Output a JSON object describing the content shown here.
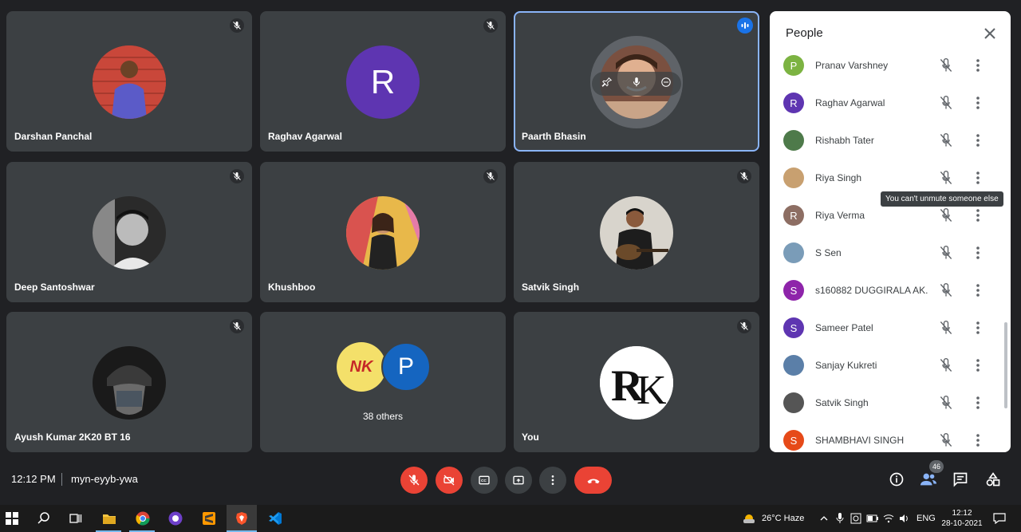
{
  "tiles": [
    {
      "name": "Darshan Panchal"
    },
    {
      "name": "Raghav Agarwal",
      "letter": "R"
    },
    {
      "name": "Paarth Bhasin"
    },
    {
      "name": "Deep Santoshwar"
    },
    {
      "name": "Khushboo"
    },
    {
      "name": "Satvik Singh"
    },
    {
      "name": "Ayush Kumar 2K20 BT 16"
    },
    {
      "name": "38 others",
      "letter": "P",
      "letter2": "NK"
    },
    {
      "name": "You"
    }
  ],
  "people_panel": {
    "title": "People",
    "tooltip": "You can't unmute someone else",
    "people": [
      {
        "name": "Pranav Varshney",
        "letter": "P",
        "color": "#7cb342"
      },
      {
        "name": "Raghav Agarwal",
        "letter": "R",
        "color": "#5e35b1"
      },
      {
        "name": "Rishabh Tater",
        "letter": "",
        "color": "#4e7a4a"
      },
      {
        "name": "Riya Singh",
        "letter": "",
        "color": "#c8a070"
      },
      {
        "name": "Riya Verma",
        "letter": "R",
        "color": "#8d6e63"
      },
      {
        "name": "S Sen",
        "letter": "",
        "color": "#7a9cb8"
      },
      {
        "name": "s160882 DUGGIRALA AK...",
        "letter": "S",
        "color": "#8e24aa"
      },
      {
        "name": "Sameer Patel",
        "letter": "S",
        "color": "#5e35b1"
      },
      {
        "name": "Sanjay Kukreti",
        "letter": "",
        "color": "#5b7fa8"
      },
      {
        "name": "Satvik Singh",
        "letter": "",
        "color": "#555555"
      },
      {
        "name": "SHAMBHAVI SINGH",
        "letter": "S",
        "color": "#e64a19"
      }
    ]
  },
  "bottom_bar": {
    "time": "12:12 PM",
    "meeting_code": "myn-eyyb-ywa",
    "participants_count": "46"
  },
  "taskbar": {
    "weather": "26°C  Haze",
    "language": "ENG",
    "time": "12:12",
    "date": "28-10-2021"
  }
}
